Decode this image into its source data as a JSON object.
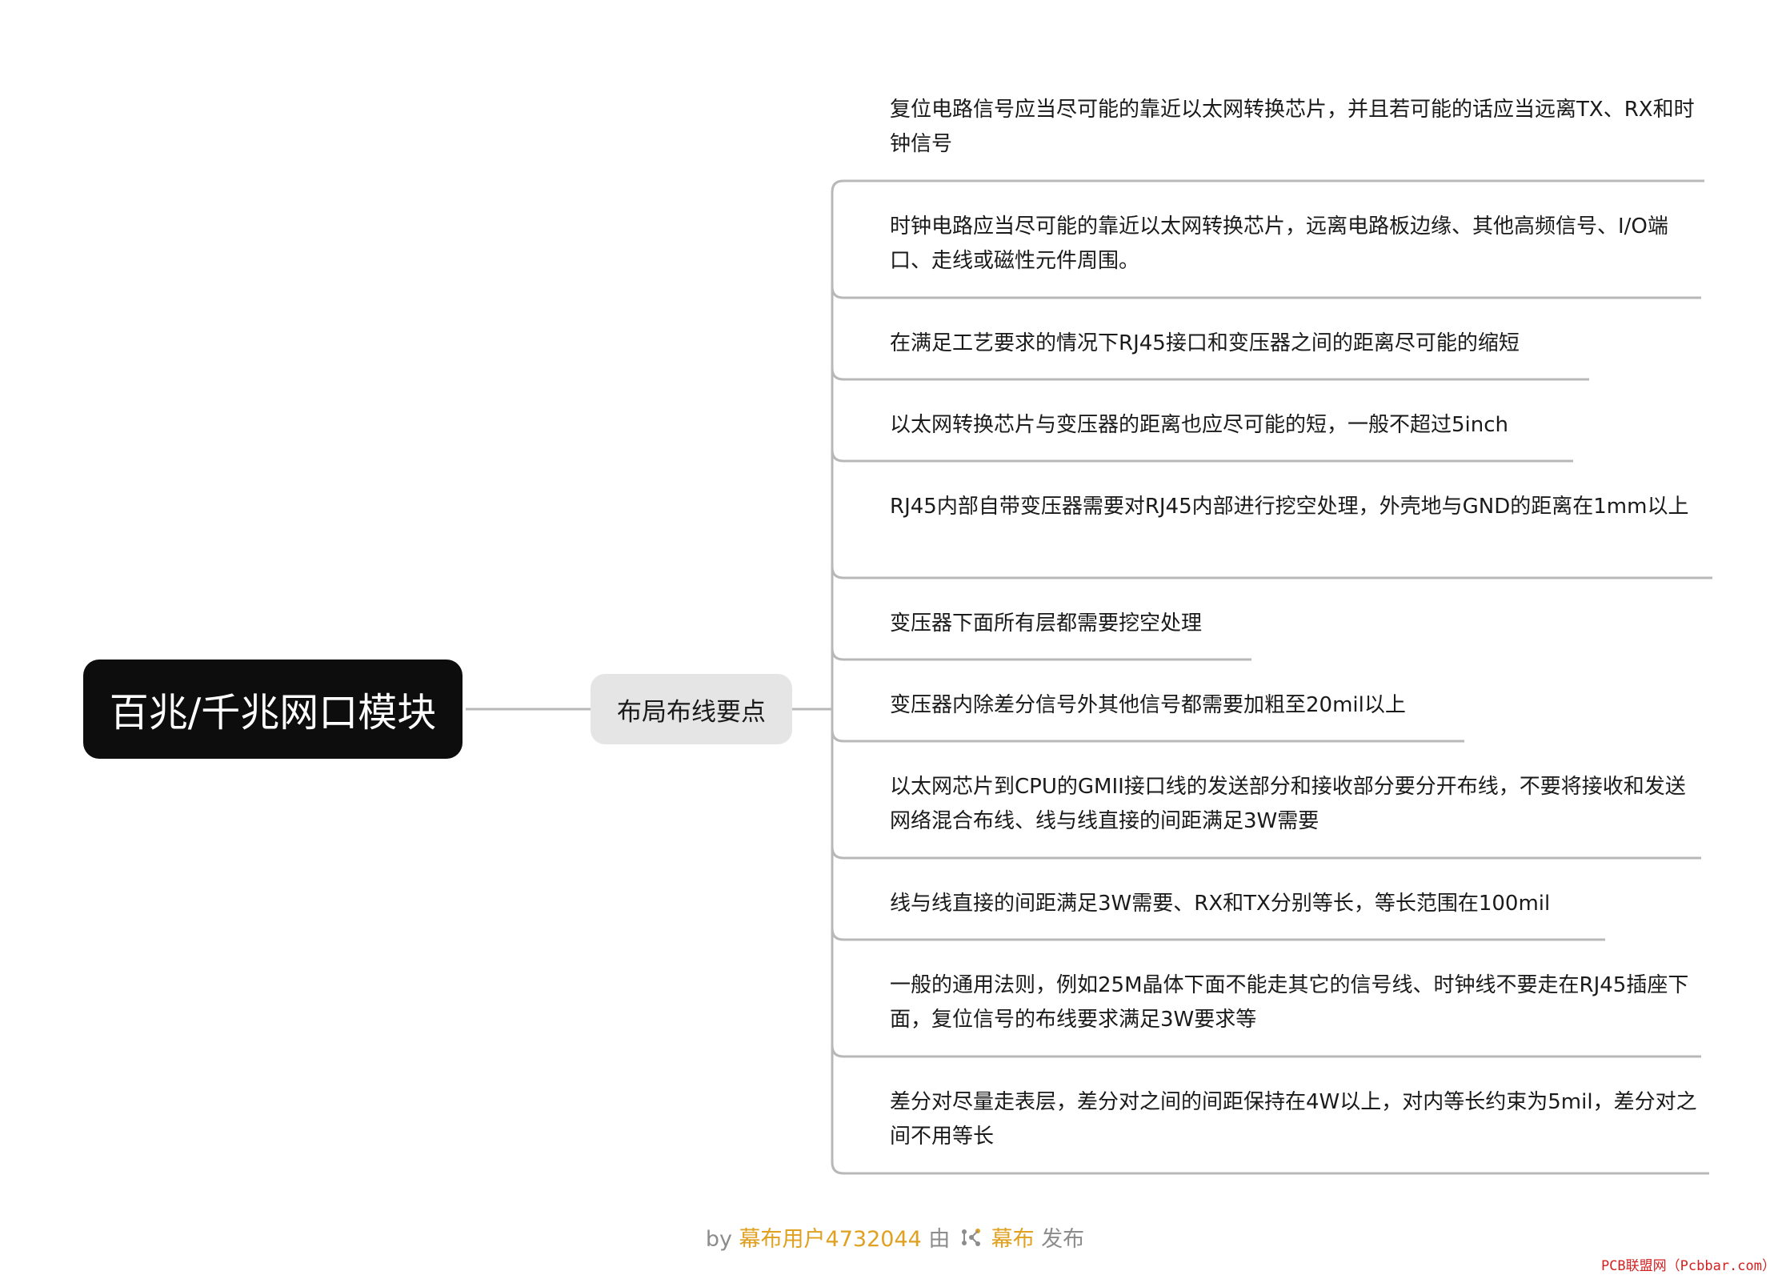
{
  "mindmap": {
    "root": "百兆/千兆网口模块",
    "branch": "布局布线要点",
    "leaves": [
      "复位电路信号应当尽可能的靠近以太网转换芯片，并且若可能的话应当远离TX、RX和时钟信号",
      "时钟电路应当尽可能的靠近以太网转换芯片，远离电路板边缘、其他高频信号、I/O端口、走线或磁性元件周围。",
      "在满足工艺要求的情况下RJ45接口和变压器之间的距离尽可能的缩短",
      "以太网转换芯片与变压器的距离也应尽可能的短，一般不超过5inch",
      "RJ45内部自带变压器需要对RJ45内部进行挖空处理，外壳地与GND的距离在1mm以上",
      "变压器下面所有层都需要挖空处理",
      "变压器内除差分信号外其他信号都需要加粗至20mil以上",
      "以太网芯片到CPU的GMII接口线的发送部分和接收部分要分开布线，不要将接收和发送网络混合布线、线与线直接的间距满足3W需要",
      "线与线直接的间距满足3W需要、RX和TX分别等长，等长范围在100mil",
      "一般的通用法则，例如25M晶体下面不能走其它的信号线、时钟线不要走在RJ45插座下面，复位信号的布线要求满足3W要求等",
      "差分对尽量走表层，差分对之间的间距保持在4W以上，对内等长约束为5mil，差分对之间不用等长"
    ]
  },
  "footer": {
    "by": "by",
    "user": "幕布用户4732044",
    "via": "由",
    "brand": "幕布",
    "publish": "发布"
  },
  "watermark": "PCB联盟网（Pcbbar.com）",
  "colors": {
    "root_bg": "#0d0d0d",
    "branch_bg": "#e5e5e5",
    "line": "#b8b8b8",
    "accent": "#e0a020"
  }
}
